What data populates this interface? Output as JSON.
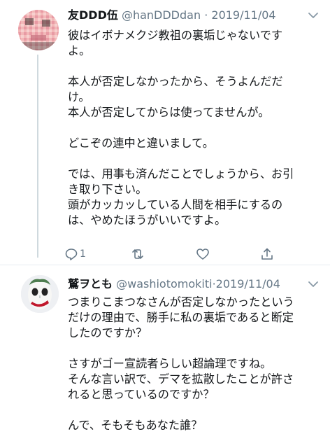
{
  "tweet1": {
    "display_name": "友DDD伍",
    "handle": "@hanDDDdan",
    "date": "2019/11/04",
    "separator": "·",
    "body": "彼はイボナメクジ教祖の裏垢じゃないです\nよ。\n\n本人が否定しなかったから、そうよんだだ\nけ。\n本人が否定してからは使ってませんが。\n\nどこぞの連中と違いまして。\n\nでは、用事も済んだことでしょうから、お引\nき取り下さい。\n頭がカッカッしている人間を相手にするの\nは、やめたほうがいいですよ。",
    "actions": {
      "reply_icon": "reply-icon",
      "reply_count": "1",
      "retweet_icon": "retweet-icon",
      "like_icon": "heart-icon",
      "share_icon": "share-icon"
    },
    "menu_icon": "chevron-down-icon"
  },
  "tweet2": {
    "display_name": "鷲ヲとも",
    "handle": "@washiotomokiti",
    "date": "2019/11/04",
    "separator": "·",
    "body": "つまりこまつなさんが否定しなかったという\nだけの理由で、勝手に私の裏垢であると断定\nしたのですか？\n\nさすがゴー宣読者らしい超論理ですね。\nそんな言い訳で、デマを拡散したことが許さ\nれると思っているのですか？\n\nんで、そもそもあなた誰？",
    "menu_icon": "chevron-down-icon"
  },
  "colors": {
    "text": "#14171a",
    "secondary": "#657786",
    "thread_line": "#cfd9de",
    "divider": "#e6ecf0"
  }
}
